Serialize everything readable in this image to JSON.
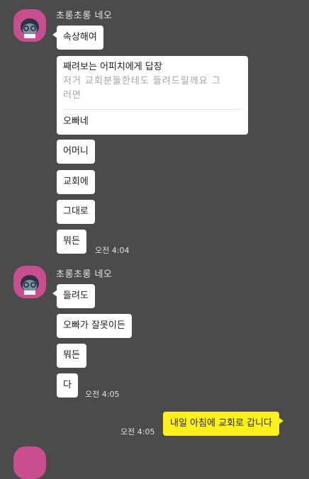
{
  "messages_1": {
    "sender": "초롱초롱 네오",
    "bubble_1": "속상해여",
    "reply": {
      "title": "째려보는 어피치에게 답장",
      "quote_line1": "저거 교회분들한테도 들려드릴께요 그",
      "quote_line2": "러면",
      "text": "오빠네"
    },
    "bubble_2": "어머니",
    "bubble_3": "교회에",
    "bubble_4": "그대로",
    "bubble_5": "뭐든",
    "time": "오전 4:04"
  },
  "messages_2": {
    "sender": "초롱초롱 네오",
    "bubble_1": "들려도",
    "bubble_2": "오빠가 잘못이든",
    "bubble_3": "뭐든",
    "bubble_4": "다",
    "time": "오전 4:05"
  },
  "my_message": {
    "time": "오전 4:05",
    "text": "내일 아침에 교회로 갑니다"
  },
  "colors": {
    "background": "#4b4b4b",
    "avatar": "#c84e8f",
    "my_bubble": "#fef01b",
    "other_bubble": "#ffffff"
  }
}
